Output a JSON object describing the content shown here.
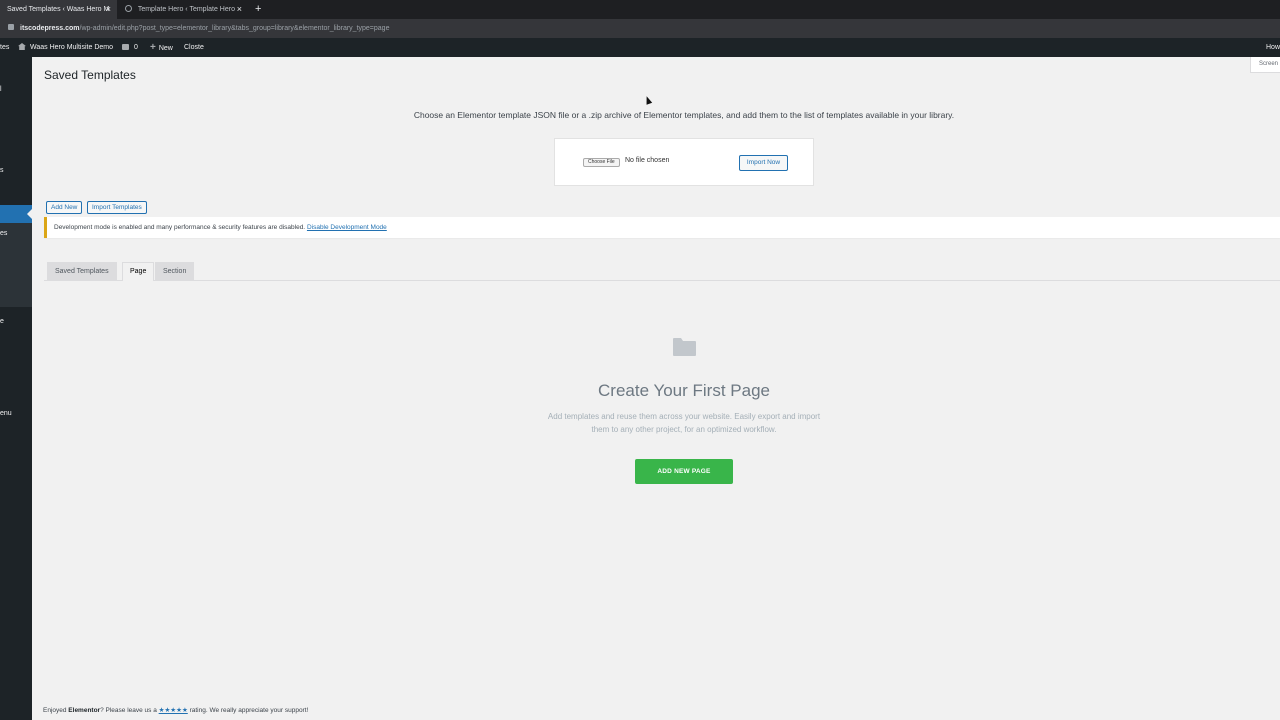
{
  "browser": {
    "tabs": [
      {
        "title": "Saved Templates ‹ Waas Hero M",
        "close": "×"
      },
      {
        "title": "Template Hero ‹ Template Hero",
        "close": "×"
      }
    ],
    "new_tab": "+",
    "url_domain": "itscodepress.com",
    "url_path": "/wp-admin/edit.php?post_type=elementor_library&tabs_group=library&elementor_library_type=page"
  },
  "admin_bar": {
    "left_cut": "tes",
    "site_name": "Waas Hero Multisite Demo",
    "comments_count": "0",
    "new_label": "New",
    "user_link": "Closte",
    "right_cut": "How"
  },
  "sidebar": {
    "fragments": [
      {
        "text": "l"
      },
      {
        "text": "s"
      },
      {
        "text": "es"
      },
      {
        "text": "e"
      },
      {
        "text": "enu"
      }
    ]
  },
  "main": {
    "page_title": "Saved Templates",
    "screen_options": "Screen",
    "import_description": "Choose an Elementor template JSON file or a .zip archive of Elementor templates, and add them to the list of templates available in your library.",
    "choose_file": "Choose File",
    "no_file": "No file chosen",
    "import_now": "Import Now",
    "add_new": "Add New",
    "import_templates": "Import Templates",
    "notice_text": "Development mode is enabled and many performance & security features are disabled.",
    "notice_link": "Disable Development Mode",
    "tabs": [
      {
        "label": "Saved Templates"
      },
      {
        "label": "Page"
      },
      {
        "label": "Section"
      }
    ],
    "empty_title": "Create Your First Page",
    "empty_desc": "Add templates and reuse them across your website. Easily export and import them to any other project, for an optimized workflow.",
    "add_new_page": "ADD NEW PAGE",
    "footer_pre": "Enjoyed ",
    "footer_brand": "Elementor",
    "footer_mid": "? Please leave us a ",
    "footer_stars": "★★★★★",
    "footer_post": " rating. We really appreciate your support!"
  },
  "colors": {
    "admin_dark": "#1d2327",
    "link_blue": "#2271b1",
    "green_button": "#39b54a",
    "notice_yellow": "#dba617"
  }
}
